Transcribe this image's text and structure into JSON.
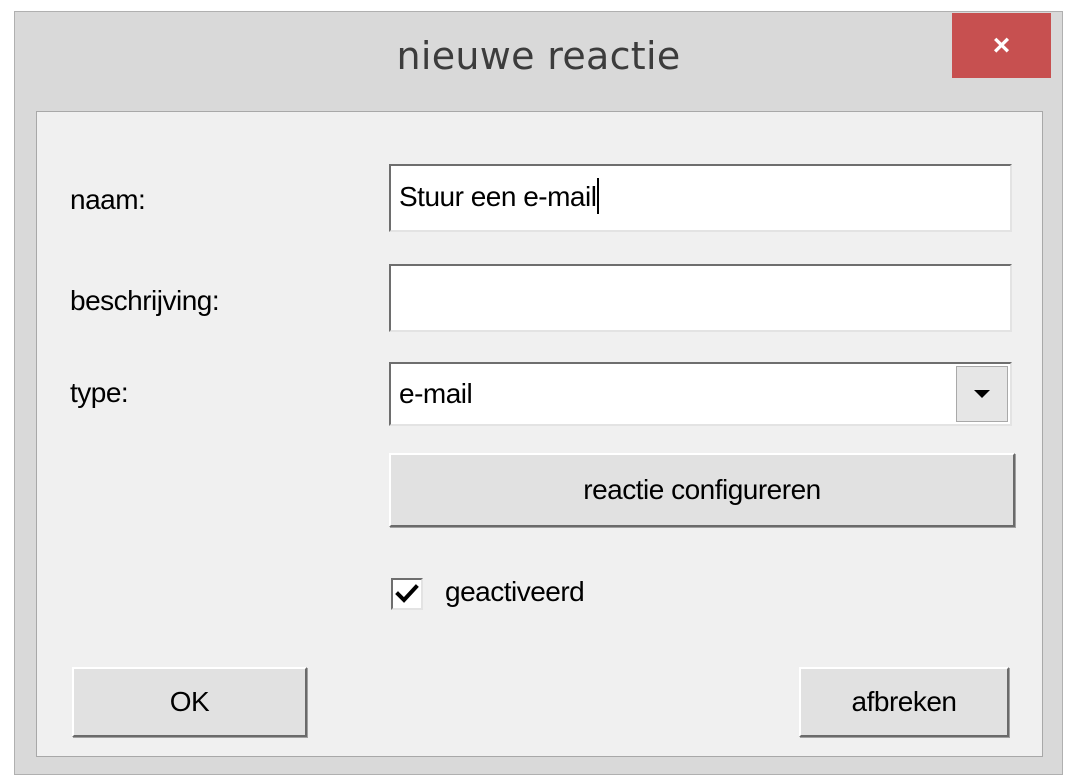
{
  "window": {
    "title": "nieuwe reactie",
    "close_glyph": "×"
  },
  "form": {
    "naam_label": "naam:",
    "naam_value": "Stuur een e-mail",
    "beschrijving_label": "beschrijving:",
    "beschrijving_value": "",
    "type_label": "type:",
    "type_selected": "e-mail",
    "configure_button_label": "reactie configureren",
    "activated_label": "geactiveerd",
    "activated_checked": true
  },
  "buttons": {
    "ok_label": "OK",
    "cancel_label": "afbreken"
  },
  "icons": {
    "close": "close-icon",
    "dropdown": "chevron-down-icon",
    "check": "checkmark-icon"
  },
  "colors": {
    "close_button": "#c75050",
    "window_frame": "#d9d9d9",
    "client_background": "#f0f0f0"
  }
}
